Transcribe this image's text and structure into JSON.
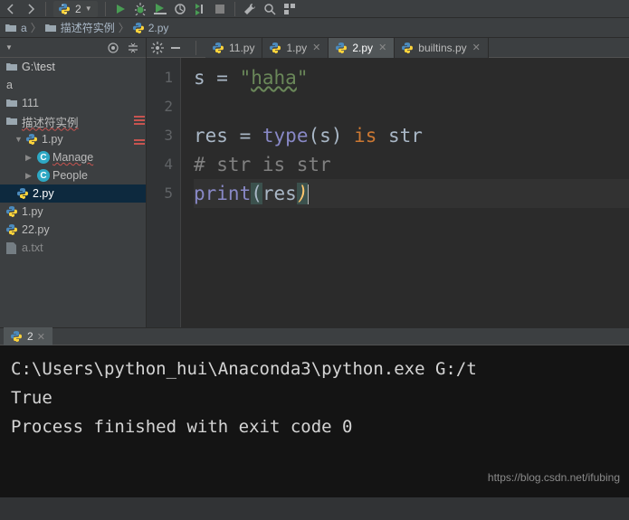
{
  "toolbar": {
    "combo_label": "2"
  },
  "breadcrumb": {
    "root": "a",
    "folder": "描述符实例",
    "file": "2.py"
  },
  "tree": {
    "root_label": "G:\\test",
    "node_a": "a",
    "node_111": "111",
    "node_desc": "描述符实例",
    "node_1py": "1.py",
    "node_manage": "Manage",
    "node_people": "People",
    "node_2py": "2.py",
    "node_1py_b": "1.py",
    "node_22py": "22.py",
    "node_atxt": "a.txt"
  },
  "tabs": {
    "t11": "11.py",
    "t1": "1.py",
    "t2": "2.py",
    "tbi": "builtins.py"
  },
  "editor": {
    "line_numbers": [
      "1",
      "2",
      "3",
      "4",
      "5"
    ],
    "l1_a": "s ",
    "l1_b": "=",
    "l1_c": " \"",
    "l1_d": "haha",
    "l1_e": "\"",
    "l3_a": "res ",
    "l3_b": "=",
    "l3_c": " ",
    "l3_d": "type",
    "l3_e": "(s) ",
    "l3_f": "is",
    "l3_g": " str",
    "l4": "# str is str",
    "l5_a": "print",
    "l5_b": "(",
    "l5_c": "res",
    "l5_d": ")"
  },
  "run": {
    "tab_label": "2",
    "out_line1": "C:\\Users\\python_hui\\Anaconda3\\python.exe G:/t",
    "out_line2": "True",
    "out_line3": "",
    "out_line4": "Process finished with exit code 0"
  },
  "watermark": "https://blog.csdn.net/ifubing"
}
